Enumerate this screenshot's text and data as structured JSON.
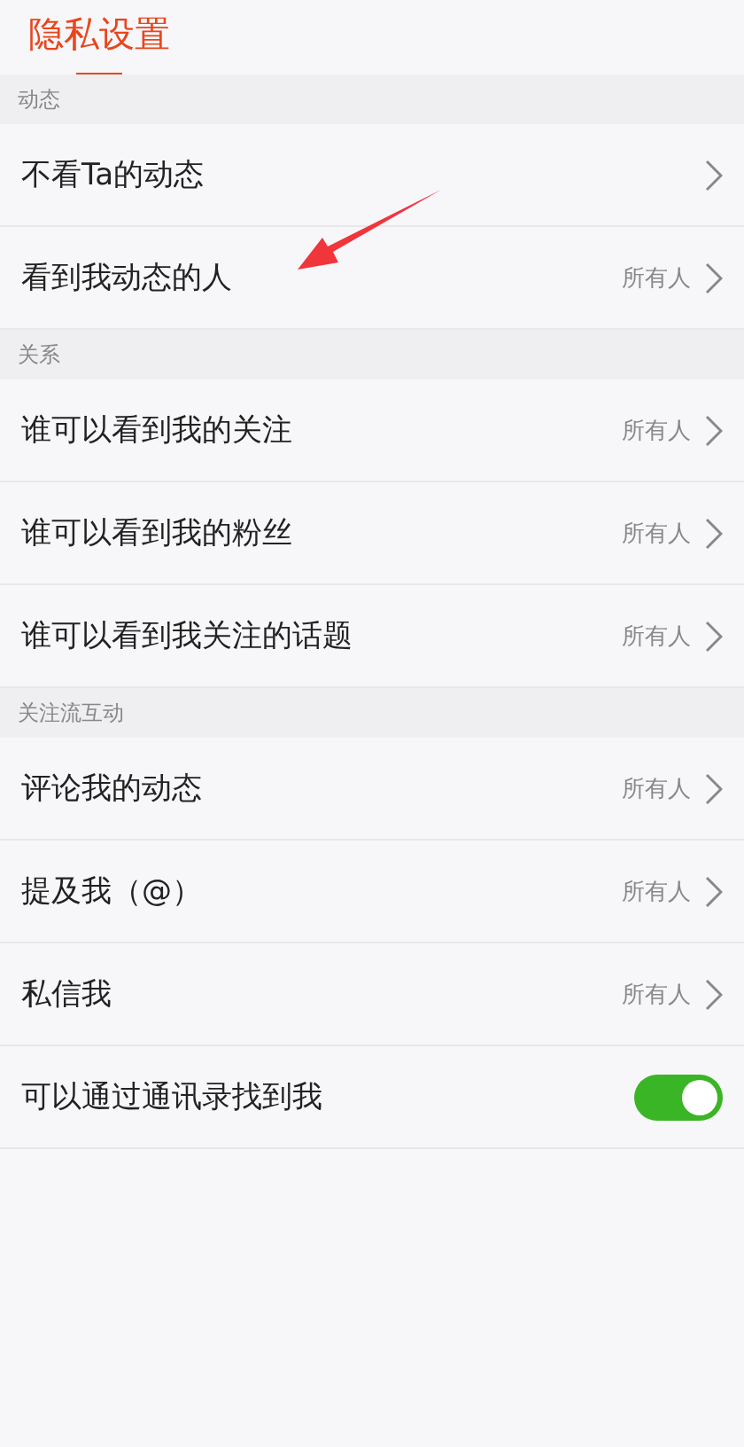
{
  "tabs": [
    {
      "label": "隐私设置",
      "selected": true
    }
  ],
  "sections": [
    {
      "title": "动态",
      "rows": [
        {
          "kind": "link",
          "label": "不看Ta的动态"
        },
        {
          "kind": "link",
          "label": "看到我动态的人",
          "value": "所有人",
          "annotated": true
        }
      ]
    },
    {
      "title": "关系",
      "rows": [
        {
          "kind": "link",
          "label": "谁可以看到我的关注",
          "value": "所有人"
        },
        {
          "kind": "link",
          "label": "谁可以看到我的粉丝",
          "value": "所有人"
        },
        {
          "kind": "link",
          "label": "谁可以看到我关注的话题",
          "value": "所有人"
        }
      ]
    },
    {
      "title": "关注流互动",
      "rows": [
        {
          "kind": "link",
          "label": "评论我的动态",
          "value": "所有人"
        },
        {
          "kind": "link",
          "label": "提及我（@）",
          "value": "所有人"
        },
        {
          "kind": "link",
          "label": "私信我",
          "value": "所有人"
        },
        {
          "kind": "toggle",
          "label": "可以通过通讯录找到我",
          "on": true
        }
      ]
    }
  ]
}
